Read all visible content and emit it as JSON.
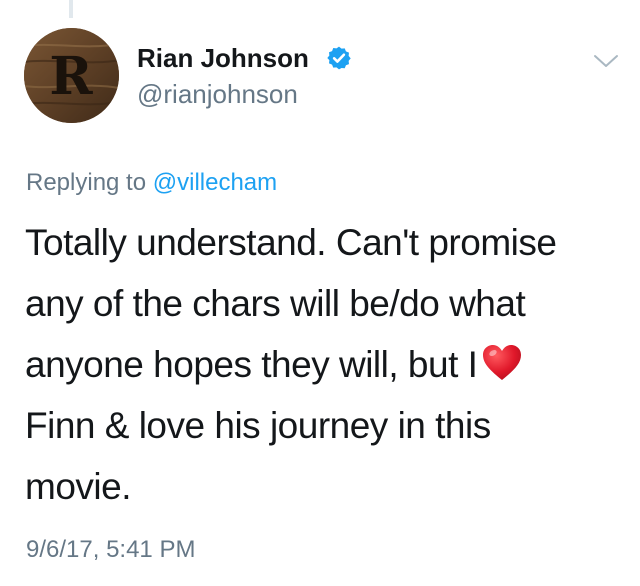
{
  "author": {
    "name": "Rian Johnson",
    "handle": "@rianjohnson",
    "avatar_letter": "R",
    "verified": true
  },
  "reply": {
    "prefix": "Replying to ",
    "mention": "@villecham"
  },
  "tweet": {
    "lines": [
      "Totally understand. Can't promise",
      "any of the chars will be/do what",
      "anyone hopes they will, but I",
      "Finn & love his journey in this",
      "movie."
    ],
    "emoji": "red-heart-icon"
  },
  "timestamp": "9/6/17, 5:41 PM",
  "colors": {
    "text": "#14171a",
    "secondary": "#657786",
    "link": "#1da1f2",
    "verified": "#1da1f2",
    "heart": "#e0182a"
  }
}
